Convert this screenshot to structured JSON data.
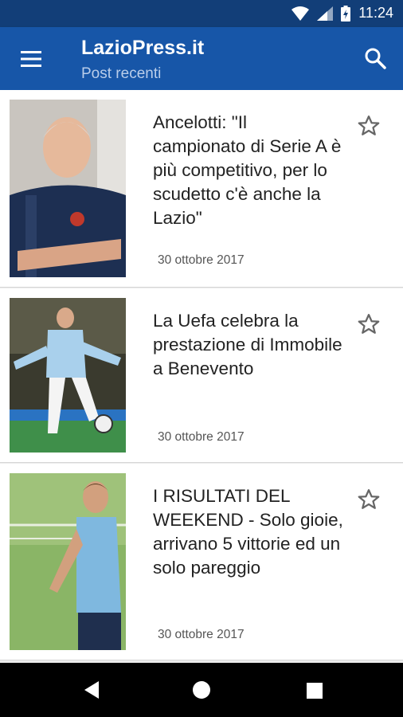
{
  "status_bar": {
    "time": "11:24",
    "icons": [
      "wifi-icon",
      "signal-icon",
      "battery-charging-icon"
    ]
  },
  "app_bar": {
    "title": "LazioPress.it",
    "subtitle": "Post recenti",
    "menu_icon": "hamburger-menu-icon",
    "search_icon": "search-icon"
  },
  "posts": [
    {
      "headline": "Ancelotti: \"Il campionato di Serie A è più competitivo, per lo scudetto c'è anche la Lazio\"",
      "date": "30 ottobre 2017",
      "bookmark_icon": "star-outline-icon"
    },
    {
      "headline": "La Uefa celebra la prestazione di Immobile a Benevento",
      "date": "30 ottobre 2017",
      "bookmark_icon": "star-outline-icon"
    },
    {
      "headline": "I RISULTATI DEL WEEKEND - Solo gioie, arrivano 5 vittorie ed un solo pareggio",
      "date": "30 ottobre 2017",
      "bookmark_icon": "star-outline-icon"
    }
  ],
  "nav_bar": {
    "icons": [
      "back-icon",
      "home-icon",
      "recents-icon"
    ]
  },
  "colors": {
    "status_bar": "#123e78",
    "app_bar": "#1756a8",
    "subtitle": "#b9cdea",
    "background": "#ececec"
  }
}
